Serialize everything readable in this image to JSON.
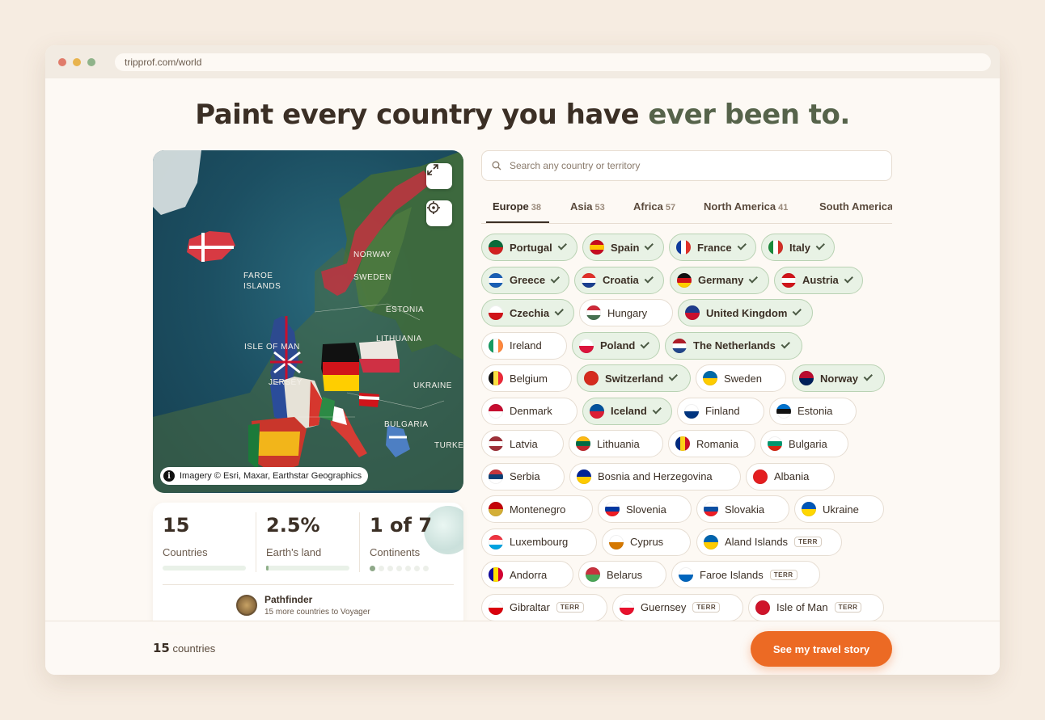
{
  "browser": {
    "url": "tripprof.com/world",
    "dots": [
      "#e07b6a",
      "#e8b34d",
      "#8fb38a"
    ]
  },
  "headline": {
    "part1": "Paint every country you have",
    "part2": "ever been to."
  },
  "map": {
    "labels": [
      "NORWAY",
      "FAROE\nISLANDS",
      "SWEDEN",
      "ESTONIA",
      "LITHUANIA",
      "ISLE OF MAN",
      "UKRAINE",
      "BULGARIA",
      "JERSEY",
      "TURKEY"
    ],
    "attribution": "Imagery © Esri, Maxar, Earthstar Geographics",
    "expand_icon": "expand-icon",
    "locate_icon": "crosshair-icon"
  },
  "stats": {
    "countries": {
      "value": "15",
      "label": "Countries",
      "progress": 0
    },
    "land": {
      "value": "2.5%",
      "label": "Earth's land",
      "progress": 0.025
    },
    "continents": {
      "value": "1 of 7",
      "label": "Continents",
      "visited": 1,
      "total": 7
    },
    "badge": {
      "title": "Pathfinder",
      "subtitle": "15 more countries to Voyager"
    }
  },
  "search": {
    "placeholder": "Search any country or territory",
    "value": ""
  },
  "tabs": [
    {
      "label": "Europe",
      "count": "38",
      "active": true
    },
    {
      "label": "Asia",
      "count": "53"
    },
    {
      "label": "Africa",
      "count": "57"
    },
    {
      "label": "North America",
      "count": "41"
    },
    {
      "label": "South America",
      "count": ""
    }
  ],
  "countries": [
    [
      {
        "name": "Portugal",
        "sel": true,
        "flag": [
          "#0a6a3a",
          "#d22020"
        ]
      },
      {
        "name": "Spain",
        "sel": true,
        "flag": [
          "#c60b1e",
          "#ffc400",
          "#c60b1e"
        ]
      },
      {
        "name": "France",
        "sel": true,
        "flag": [
          "#0d3b9e",
          "#ffffff",
          "#e0302a"
        ],
        "v": true
      },
      {
        "name": "Italy",
        "sel": true,
        "flag": [
          "#1b8a3c",
          "#ffffff",
          "#d22f27"
        ],
        "v": true
      }
    ],
    [
      {
        "name": "Greece",
        "sel": true,
        "flag": [
          "#1a5fb4",
          "#ffffff",
          "#1a5fb4"
        ]
      },
      {
        "name": "Croatia",
        "sel": true,
        "flag": [
          "#e0302a",
          "#ffffff",
          "#1b3f8f"
        ]
      },
      {
        "name": "Germany",
        "sel": true,
        "flag": [
          "#111111",
          "#d0141a",
          "#ffce00"
        ]
      },
      {
        "name": "Austria",
        "sel": true,
        "flag": [
          "#d0141a",
          "#ffffff",
          "#d0141a"
        ]
      }
    ],
    [
      {
        "name": "Czechia",
        "sel": true,
        "flag": [
          "#ffffff",
          "#d0141a"
        ]
      },
      {
        "name": "Hungary",
        "sel": false,
        "flag": [
          "#ce2939",
          "#ffffff",
          "#477050"
        ]
      },
      {
        "name": "United Kingdom",
        "sel": true,
        "flag": [
          "#1d3b8b",
          "#c8102e"
        ]
      }
    ],
    [
      {
        "name": "Ireland",
        "sel": false,
        "flag": [
          "#169b62",
          "#ffffff",
          "#ff883e"
        ],
        "v": true
      },
      {
        "name": "Poland",
        "sel": true,
        "flag": [
          "#ffffff",
          "#dc143c"
        ]
      },
      {
        "name": "The Netherlands",
        "sel": true,
        "flag": [
          "#ae1c28",
          "#ffffff",
          "#21468b"
        ]
      }
    ],
    [
      {
        "name": "Belgium",
        "sel": false,
        "flag": [
          "#111111",
          "#fae042",
          "#ed2939"
        ],
        "v": true
      },
      {
        "name": "Switzerland",
        "sel": true,
        "flag": [
          "#d52b1e",
          "#d52b1e"
        ]
      },
      {
        "name": "Sweden",
        "sel": false,
        "flag": [
          "#006aa7",
          "#fecc00"
        ]
      },
      {
        "name": "Norway",
        "sel": true,
        "flag": [
          "#ba0c2f",
          "#00205b"
        ]
      }
    ],
    [
      {
        "name": "Denmark",
        "sel": false,
        "flag": [
          "#c60c30",
          "#ffffff"
        ]
      },
      {
        "name": "Iceland",
        "sel": true,
        "flag": [
          "#02529c",
          "#dc1e35"
        ]
      },
      {
        "name": "Finland",
        "sel": false,
        "flag": [
          "#ffffff",
          "#003580"
        ]
      },
      {
        "name": "Estonia",
        "sel": false,
        "flag": [
          "#0072ce",
          "#111111",
          "#ffffff"
        ]
      }
    ],
    [
      {
        "name": "Latvia",
        "sel": false,
        "flag": [
          "#9e3039",
          "#ffffff",
          "#9e3039"
        ]
      },
      {
        "name": "Lithuania",
        "sel": false,
        "flag": [
          "#fdb913",
          "#006a44",
          "#c1272d"
        ]
      },
      {
        "name": "Romania",
        "sel": false,
        "flag": [
          "#002b7f",
          "#fcd116",
          "#ce1126"
        ],
        "v": true
      },
      {
        "name": "Bulgaria",
        "sel": false,
        "flag": [
          "#ffffff",
          "#00966e",
          "#d62612"
        ]
      }
    ],
    [
      {
        "name": "Serbia",
        "sel": false,
        "flag": [
          "#c6363c",
          "#0c4076",
          "#ffffff"
        ]
      },
      {
        "name": "Bosnia and Herzegovina",
        "sel": false,
        "flag": [
          "#002395",
          "#fecb00"
        ]
      },
      {
        "name": "Albania",
        "sel": false,
        "flag": [
          "#e41e20",
          "#e41e20"
        ]
      }
    ],
    [
      {
        "name": "Montenegro",
        "sel": false,
        "flag": [
          "#c40308",
          "#d4af37"
        ]
      },
      {
        "name": "Slovenia",
        "sel": false,
        "flag": [
          "#ffffff",
          "#0037a0",
          "#ed1c24"
        ]
      },
      {
        "name": "Slovakia",
        "sel": false,
        "flag": [
          "#ffffff",
          "#0b4ea2",
          "#ee1c25"
        ]
      },
      {
        "name": "Ukraine",
        "sel": false,
        "flag": [
          "#0057b7",
          "#ffd700"
        ]
      }
    ],
    [
      {
        "name": "Luxembourg",
        "sel": false,
        "flag": [
          "#ef3340",
          "#ffffff",
          "#00a3e0"
        ]
      },
      {
        "name": "Cyprus",
        "sel": false,
        "flag": [
          "#ffffff",
          "#d57800"
        ]
      },
      {
        "name": "Aland Islands",
        "sel": false,
        "terr": "TERR",
        "flag": [
          "#0064ae",
          "#fecb00"
        ]
      }
    ],
    [
      {
        "name": "Andorra",
        "sel": false,
        "flag": [
          "#10069f",
          "#fedf00",
          "#d50032"
        ],
        "v": true
      },
      {
        "name": "Belarus",
        "sel": false,
        "flag": [
          "#c8313e",
          "#4aa657"
        ]
      },
      {
        "name": "Faroe Islands",
        "sel": false,
        "terr": "TERR",
        "flag": [
          "#ffffff",
          "#0065bd"
        ]
      }
    ],
    [
      {
        "name": "Gibraltar",
        "sel": false,
        "terr": "TERR",
        "flag": [
          "#ffffff",
          "#da000c"
        ]
      },
      {
        "name": "Guernsey",
        "sel": false,
        "terr": "TERR",
        "flag": [
          "#ffffff",
          "#e8112d"
        ]
      },
      {
        "name": "Isle of Man",
        "sel": false,
        "terr": "TERR",
        "flag": [
          "#cf142b",
          "#cf142b"
        ]
      }
    ]
  ],
  "footer": {
    "count": "15",
    "count_label": "countries",
    "cta": "See my travel story"
  }
}
